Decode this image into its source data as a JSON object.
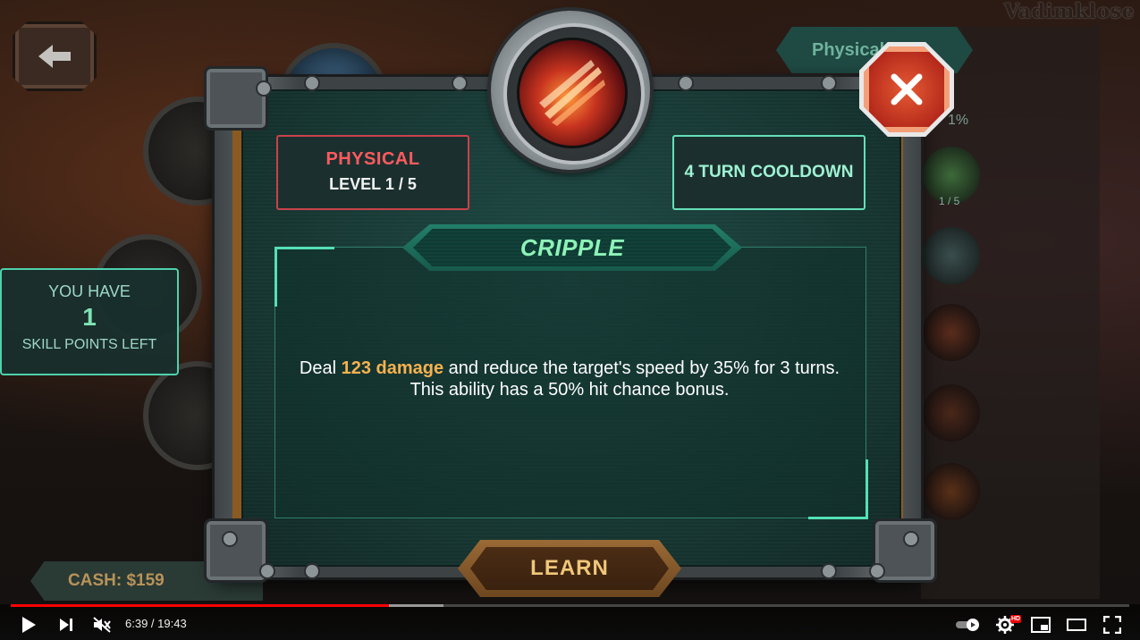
{
  "watermark": "Vadimklose",
  "background": {
    "right_tab_label": "Physical",
    "right_panel_percent": "1%",
    "right_panel_level": "1 / 5",
    "cash_label": "CASH: $159"
  },
  "skill_points": {
    "line1": "YOU HAVE",
    "count": "1",
    "line2": "SKILL POINTS LEFT"
  },
  "dialog": {
    "category": "PHYSICAL",
    "level": "LEVEL 1 / 5",
    "cooldown": "4 TURN COOLDOWN",
    "skill_name": "CRIPPLE",
    "description": {
      "prefix": "Deal ",
      "highlight": "123 damage",
      "suffix": " and reduce the target's speed by 35% for 3 turns. This ability has a 50% hit chance bonus."
    },
    "learn_label": "LEARN",
    "close_symbol": "✕",
    "emblem_icon": "claw-slash-icon"
  },
  "player": {
    "time": "6:39 / 19:43",
    "progress_fraction": 0.3385,
    "hd_label": "HD"
  },
  "colors": {
    "accent_teal": "#54e0b5",
    "physical_red": "#ff5a5f",
    "damage_orange": "#f6b24f",
    "close_red": "#d9432a",
    "progress_red": "#ff0000"
  }
}
